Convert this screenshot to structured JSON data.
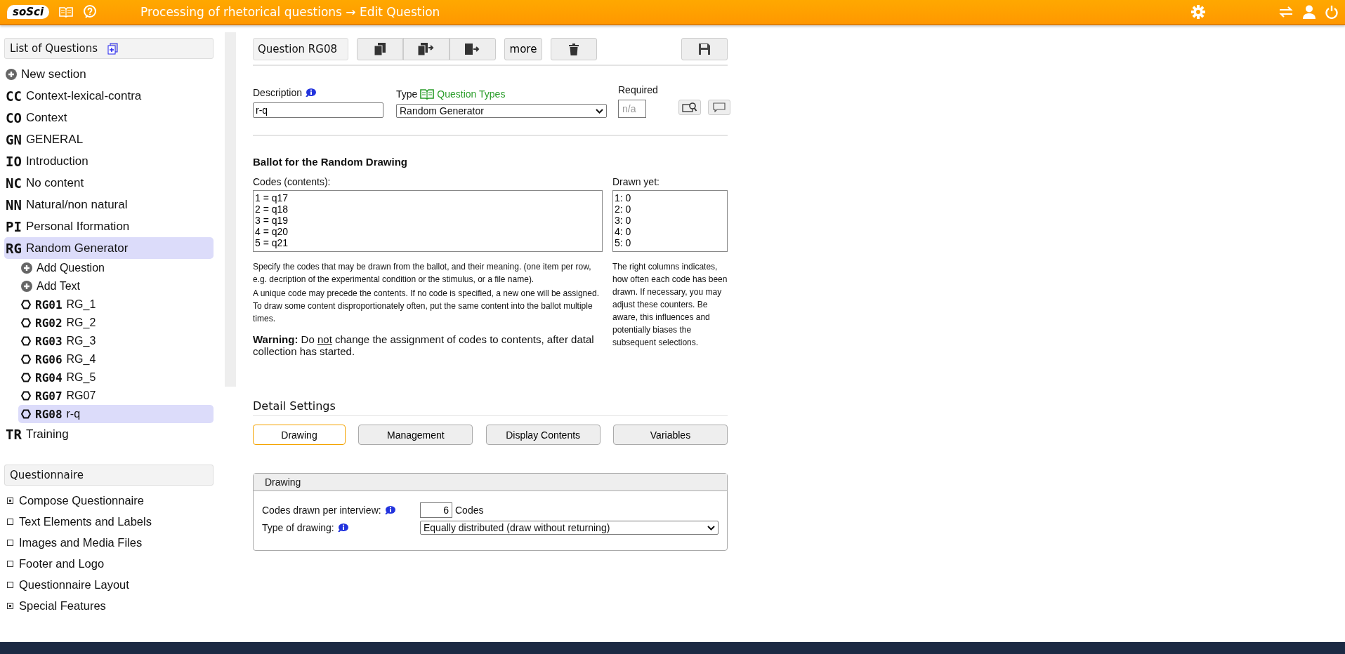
{
  "topbar": {
    "logo": "soSci",
    "title": "Processing of rhetorical questions → Edit Question"
  },
  "sidebar": {
    "questions_title": "List of Questions",
    "sections": [
      {
        "kind": "add",
        "label": "New section",
        "selected": false
      },
      {
        "kind": "section",
        "code": "CC",
        "label": "Context-lexical-contra",
        "selected": false
      },
      {
        "kind": "section",
        "code": "CO",
        "label": "Context",
        "selected": false
      },
      {
        "kind": "section",
        "code": "GN",
        "label": "GENERAL",
        "selected": false
      },
      {
        "kind": "section",
        "code": "IO",
        "label": "Introduction",
        "selected": false
      },
      {
        "kind": "section",
        "code": "NC",
        "label": "No content",
        "selected": false
      },
      {
        "kind": "section",
        "code": "NN",
        "label": "Natural/non natural",
        "selected": false
      },
      {
        "kind": "section",
        "code": "PI",
        "label": "Personal Iformation",
        "selected": false
      },
      {
        "kind": "section",
        "code": "RG",
        "label": "Random Generator",
        "selected": true,
        "children": [
          {
            "kind": "add",
            "label": "Add Question",
            "selected": false
          },
          {
            "kind": "add",
            "label": "Add Text",
            "selected": false
          },
          {
            "kind": "question",
            "code": "RG01",
            "label": "RG_1",
            "selected": false
          },
          {
            "kind": "question",
            "code": "RG02",
            "label": "RG_2",
            "selected": false
          },
          {
            "kind": "question",
            "code": "RG03",
            "label": "RG_3",
            "selected": false
          },
          {
            "kind": "question",
            "code": "RG06",
            "label": "RG_4",
            "selected": false
          },
          {
            "kind": "question",
            "code": "RG04",
            "label": "RG_5",
            "selected": false
          },
          {
            "kind": "question",
            "code": "RG07",
            "label": "RG07",
            "selected": false
          },
          {
            "kind": "question",
            "code": "RG08",
            "label": "r-q",
            "selected": true
          }
        ]
      },
      {
        "kind": "section",
        "code": "TR",
        "label": "Training",
        "selected": false
      }
    ],
    "questionnaire_title": "Questionnaire",
    "questionnaire_items": [
      {
        "label": "Compose Questionnaire",
        "kind": "group"
      },
      {
        "label": "Text Elements and Labels",
        "kind": "page"
      },
      {
        "label": "Images and Media Files",
        "kind": "page"
      },
      {
        "label": "Footer and Logo",
        "kind": "page"
      },
      {
        "label": "Questionnaire Layout",
        "kind": "page"
      },
      {
        "label": "Special Features",
        "kind": "group"
      }
    ]
  },
  "editor": {
    "question_label": "Question RG08",
    "more_button": "more",
    "description": {
      "label": "Description",
      "value": "r-q"
    },
    "type": {
      "label": "Type",
      "link": "Question Types",
      "value": "Random Generator"
    },
    "required": {
      "label": "Required",
      "placeholder": "n/a"
    },
    "ballot": {
      "title": "Ballot for the Random Drawing",
      "codes_label": "Codes (contents):",
      "codes": [
        "1 = q17",
        "2 = q18",
        "3 = q19",
        "4 = q20",
        "5 = q21"
      ],
      "drawn_label": "Drawn yet:",
      "drawn": [
        "1: 0",
        "2: 0",
        "3: 0",
        "4: 0",
        "5: 0"
      ],
      "help": [
        "Specify the codes that may be drawn from the ballot, and their meaning. (one item per row, e.g. decription of the experimental condition or the stimulus, or a file name).",
        "A unique code may precede the contents. If no code is specified, a new one will be assigned. To draw some content disproportionately often, put the same content into the ballot multiple times."
      ],
      "warning": {
        "label": "Warning:",
        "before": "Do",
        "emphasis": "not",
        "after": "change the assignment of codes to contents, after datal collection has started."
      },
      "drawn_help": "The right columns indicates, how often each code has been drawn. If necessary, you may adjust these counters. Be aware, this influences and potentially biases the subsequent selections."
    },
    "detail": {
      "title": "Detail Settings",
      "tabs": [
        {
          "label": "Drawing",
          "selected": true
        },
        {
          "label": "Management",
          "selected": false
        },
        {
          "label": "Display Contents",
          "selected": false
        },
        {
          "label": "Variables",
          "selected": false
        }
      ],
      "panel": {
        "title": "Drawing",
        "codes_per_interview": {
          "label": "Codes drawn per interview:",
          "value": "6",
          "unit": "Codes"
        },
        "type_of_drawing": {
          "label": "Type of drawing:",
          "value": "Equally distributed (draw without returning)"
        }
      }
    }
  }
}
